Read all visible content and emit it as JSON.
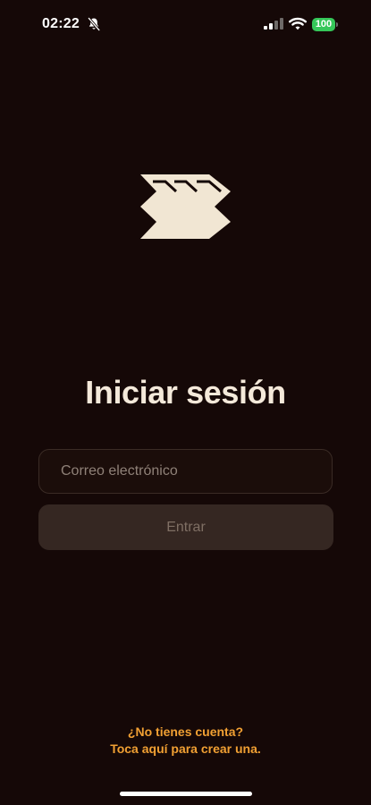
{
  "status_bar": {
    "time": "02:22",
    "battery": "100",
    "icons": [
      "bell-slash-icon",
      "signal-icon",
      "wifi-icon",
      "battery-icon"
    ],
    "battery_color": "#35C759"
  },
  "logo": {
    "icon": "chevron-mark-logo"
  },
  "login": {
    "title": "Iniciar sesión",
    "email_placeholder": "Correo electrónico",
    "email_value": "",
    "submit_label": "Entrar"
  },
  "signup": {
    "line1": "¿No tienes cuenta?",
    "line2": "Toca aquí para crear una."
  },
  "colors": {
    "background": "#150807",
    "title": "#F4E9DA",
    "field_border": "#3A2B25",
    "button_background": "#352722",
    "button_text": "#7F6F64",
    "link_accent": "#F1A033"
  }
}
